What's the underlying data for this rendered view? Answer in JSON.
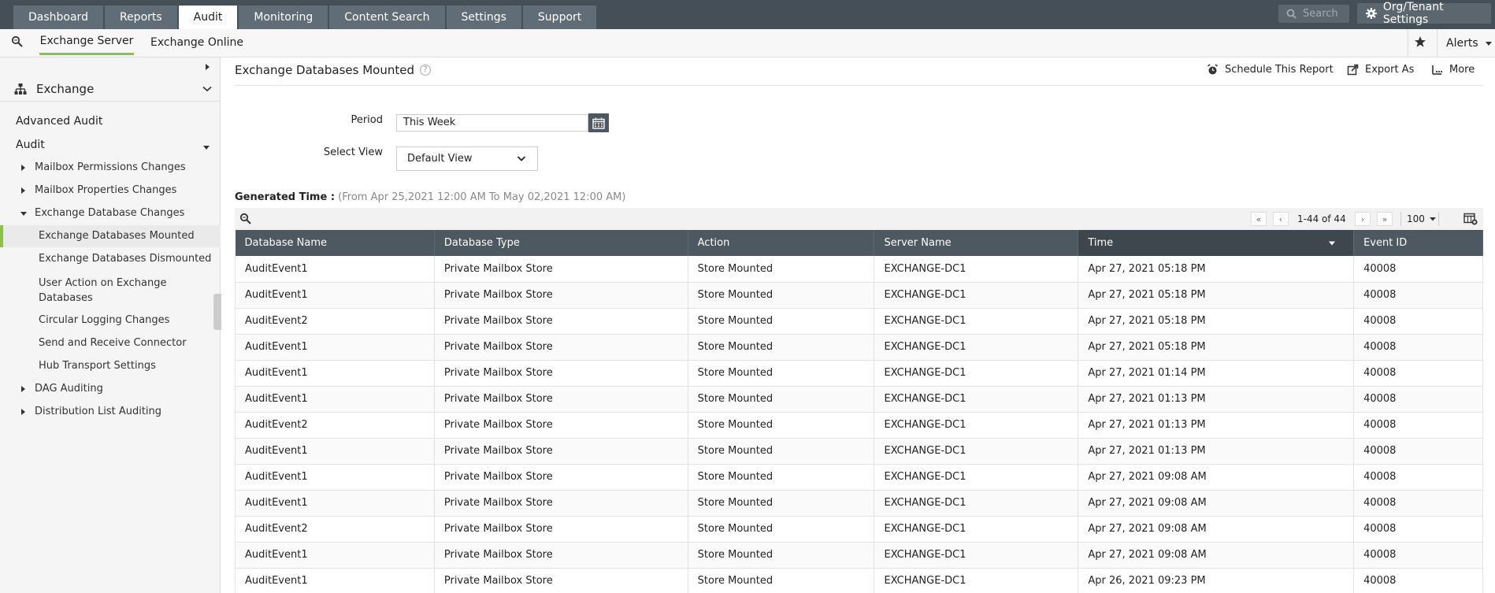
{
  "topnav": {
    "tabs": [
      {
        "label": "Dashboard",
        "active": false
      },
      {
        "label": "Reports",
        "active": false
      },
      {
        "label": "Audit",
        "active": true
      },
      {
        "label": "Monitoring",
        "active": false
      },
      {
        "label": "Content Search",
        "active": false
      },
      {
        "label": "Settings",
        "active": false
      },
      {
        "label": "Support",
        "active": false
      }
    ],
    "search_placeholder": "Search",
    "org_settings_label": "Org/Tenant Settings"
  },
  "subnav": {
    "tabs": [
      {
        "label": "Exchange Server",
        "active": true
      },
      {
        "label": "Exchange Online",
        "active": false
      }
    ],
    "alerts_label": "Alerts"
  },
  "sidebar": {
    "header": "Exchange",
    "items": [
      {
        "label": "Advanced Audit"
      },
      {
        "label": "Audit"
      },
      {
        "label": "Mailbox Permissions Changes"
      },
      {
        "label": "Mailbox Properties Changes"
      },
      {
        "label": "Exchange Database Changes"
      },
      {
        "label": "Exchange Databases Mounted"
      },
      {
        "label": "Exchange Databases Dismounted"
      },
      {
        "label": "User Action on Exchange Databases"
      },
      {
        "label": "Circular Logging Changes"
      },
      {
        "label": "Send and Receive Connector"
      },
      {
        "label": "Hub Transport Settings"
      },
      {
        "label": "DAG Auditing"
      },
      {
        "label": "Distribution List Auditing"
      }
    ]
  },
  "report": {
    "title": "Exchange Databases Mounted",
    "actions": {
      "schedule": "Schedule This Report",
      "export": "Export As",
      "more": "More"
    },
    "period_label": "Period",
    "period_value": "This Week",
    "view_label": "Select View",
    "view_value": "Default View",
    "generated_label": "Generated Time :",
    "generated_range": "(From Apr 25,2021 12:00 AM To May 02,2021 12:00 AM)",
    "pagination": {
      "range": "1-44 of 44",
      "page_size": "100"
    }
  },
  "table": {
    "columns": [
      "Database Name",
      "Database Type",
      "Action",
      "Server Name",
      "Time",
      "Event ID"
    ],
    "rows": [
      [
        "AuditEvent1",
        "Private Mailbox Store",
        "Store Mounted",
        "EXCHANGE-DC1",
        "Apr 27, 2021 05:18 PM",
        "40008"
      ],
      [
        "AuditEvent1",
        "Private Mailbox Store",
        "Store Mounted",
        "EXCHANGE-DC1",
        "Apr 27, 2021 05:18 PM",
        "40008"
      ],
      [
        "AuditEvent2",
        "Private Mailbox Store",
        "Store Mounted",
        "EXCHANGE-DC1",
        "Apr 27, 2021 05:18 PM",
        "40008"
      ],
      [
        "AuditEvent1",
        "Private Mailbox Store",
        "Store Mounted",
        "EXCHANGE-DC1",
        "Apr 27, 2021 05:18 PM",
        "40008"
      ],
      [
        "AuditEvent1",
        "Private Mailbox Store",
        "Store Mounted",
        "EXCHANGE-DC1",
        "Apr 27, 2021 01:14 PM",
        "40008"
      ],
      [
        "AuditEvent1",
        "Private Mailbox Store",
        "Store Mounted",
        "EXCHANGE-DC1",
        "Apr 27, 2021 01:13 PM",
        "40008"
      ],
      [
        "AuditEvent2",
        "Private Mailbox Store",
        "Store Mounted",
        "EXCHANGE-DC1",
        "Apr 27, 2021 01:13 PM",
        "40008"
      ],
      [
        "AuditEvent1",
        "Private Mailbox Store",
        "Store Mounted",
        "EXCHANGE-DC1",
        "Apr 27, 2021 01:13 PM",
        "40008"
      ],
      [
        "AuditEvent1",
        "Private Mailbox Store",
        "Store Mounted",
        "EXCHANGE-DC1",
        "Apr 27, 2021 09:08 AM",
        "40008"
      ],
      [
        "AuditEvent1",
        "Private Mailbox Store",
        "Store Mounted",
        "EXCHANGE-DC1",
        "Apr 27, 2021 09:08 AM",
        "40008"
      ],
      [
        "AuditEvent2",
        "Private Mailbox Store",
        "Store Mounted",
        "EXCHANGE-DC1",
        "Apr 27, 2021 09:08 AM",
        "40008"
      ],
      [
        "AuditEvent1",
        "Private Mailbox Store",
        "Store Mounted",
        "EXCHANGE-DC1",
        "Apr 27, 2021 09:08 AM",
        "40008"
      ],
      [
        "AuditEvent1",
        "Private Mailbox Store",
        "Store Mounted",
        "EXCHANGE-DC1",
        "Apr 26, 2021 09:23 PM",
        "40008"
      ]
    ]
  },
  "colors": {
    "topbar": "#454f57",
    "accent": "#8bc53f",
    "header": "#4d5860"
  }
}
